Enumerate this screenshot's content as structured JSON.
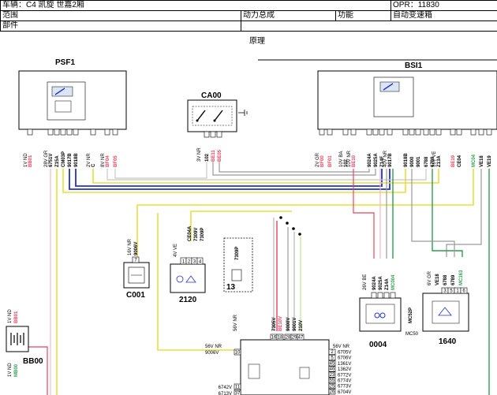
{
  "header": {
    "vehicle_label": "车辆：C4 凯旋 世嘉2厢",
    "opr_label": "OPR：11830",
    "scope_label": "范围",
    "system_label": "动力总成",
    "function_label": "功能",
    "function_value": "自动变速箱",
    "part_label": "部件",
    "principle_label": "原理"
  },
  "components": {
    "psf1": "PSF1",
    "bsi1": "BSI1",
    "ca00": "CA00",
    "c001": "C001",
    "c2120": "2120",
    "c13": "13",
    "bb00": "BB00",
    "c0004": "0004",
    "c1640": "1640"
  },
  "psf1_pins": [
    {
      "color": "1V ND",
      "wire": "BB01",
      "wire_color": "#e8455e"
    },
    {
      "color": "28V GR",
      "wire": "6751V",
      "wire_color": "#000000"
    },
    {
      "color": "",
      "wire": "Z15A",
      "wire_color": "#000000"
    },
    {
      "color": "",
      "wire": "CM03P",
      "wire_color": "#000000"
    },
    {
      "color": "",
      "wire": "9017B",
      "wire_color": "#000000"
    },
    {
      "color": "",
      "wire": "9018B",
      "wire_color": "#000000"
    },
    {
      "color": "2V NR",
      "wire": "C",
      "wire_color": "#000000"
    },
    {
      "color": "8V NR",
      "wire": "BF04",
      "wire_color": "#e8455e"
    },
    {
      "color": "",
      "wire": "BF05",
      "wire_color": "#e8455e"
    }
  ],
  "bsi1_pins": [
    {
      "color": "2V GR",
      "wire": "BF00",
      "wire_color": "#e8455e"
    },
    {
      "color": "",
      "wire": "BF01",
      "wire_color": "#e8455e"
    },
    {
      "color": "10V BA",
      "wire": "102",
      "wire_color": "#000000"
    },
    {
      "color": "10V NR",
      "wire": "BE10",
      "wire_color": "#e8455e"
    },
    {
      "color": "",
      "wire": "9024A",
      "wire_color": "#000000"
    },
    {
      "color": "",
      "wire": "9025A",
      "wire_color": "#000000"
    },
    {
      "color": "",
      "wire": "Z14F",
      "wire_color": "#000000"
    },
    {
      "color": "40V NR",
      "wire": "9017B",
      "wire_color": "#000000"
    },
    {
      "color": "",
      "wire": "9018B",
      "wire_color": "#000000"
    },
    {
      "color": "",
      "wire": "9000",
      "wire_color": "#000000"
    },
    {
      "color": "",
      "wire": "9001",
      "wire_color": "#000000"
    },
    {
      "color": "",
      "wire": "6788",
      "wire_color": "#000000"
    },
    {
      "color": "",
      "wire": "6789",
      "wire_color": "#000000"
    },
    {
      "color": "16V VE",
      "wire": "Z13A",
      "wire_color": "#000000"
    },
    {
      "color": "",
      "wire": "BE19",
      "wire_color": "#e8455e"
    },
    {
      "color": "",
      "wire": "CE04",
      "wire_color": "#000000"
    },
    {
      "color": "",
      "wire": "MC04",
      "wire_color": "#2e9e4f"
    },
    {
      "color": "",
      "wire": "VE18",
      "wire_color": "#000000"
    },
    {
      "color": "",
      "wire": "VE19",
      "wire_color": "#000000"
    }
  ],
  "ca00_pins": {
    "color": "3V NR",
    "wires": [
      "102",
      "BE11",
      "BE05"
    ]
  },
  "c001_pins": {
    "color": "16V NR",
    "wire": "9006V",
    "pin": "7"
  },
  "c2120_pins": {
    "color": "4V VE",
    "wires": [
      "CE04A",
      "7309V",
      "7309P"
    ],
    "pins": [
      "1",
      "2",
      "3",
      "4"
    ]
  },
  "c13_pins": {
    "wire": "7309P"
  },
  "bb00_pins": [
    {
      "color": "1V ND",
      "wire": "BB01"
    },
    {
      "color": "1V ND",
      "wire": "MB00"
    }
  ],
  "c0004_pins": {
    "color": "26V BE",
    "wires": [
      "9024A",
      "9025A",
      "Z14A",
      "MC004"
    ],
    "extra": "MC52P",
    "extra2": "MC50"
  },
  "c1640_pins": {
    "color": "6V GR",
    "wires": [
      "VE18",
      "6788",
      "6789",
      "MC163"
    ],
    "pins": [
      "3",
      "5",
      "1",
      "6"
    ]
  },
  "ecu": {
    "top_label": "56V NR",
    "top_wires": [
      "7305V",
      "BE10V",
      "9000V",
      "9001V",
      "210V"
    ],
    "top_pins": [
      "16",
      "18",
      "28",
      "29",
      "47"
    ],
    "left_label": "56V NR",
    "left_wire": "9006V",
    "left_pin": "10",
    "left_bottom_wires": [
      "6742V",
      "6713V"
    ],
    "left_bottom_pins": [
      "11",
      "37"
    ],
    "right_label": "56V NR",
    "right_wires": [
      "6705V",
      "6706V",
      "1361V",
      "1362V",
      "6772V",
      "6774V",
      "6773V",
      "6704V"
    ],
    "right_pins": [
      "2",
      "5",
      "45",
      "46",
      "23",
      "55",
      "25",
      "26"
    ]
  },
  "wire_colors": {
    "yellow": "#e6e03a",
    "blue": "#2233cc",
    "green": "#2e9e4f",
    "pink": "#e8455e",
    "gray": "#9a9a9a",
    "light_pink": "#f2b8c6"
  }
}
